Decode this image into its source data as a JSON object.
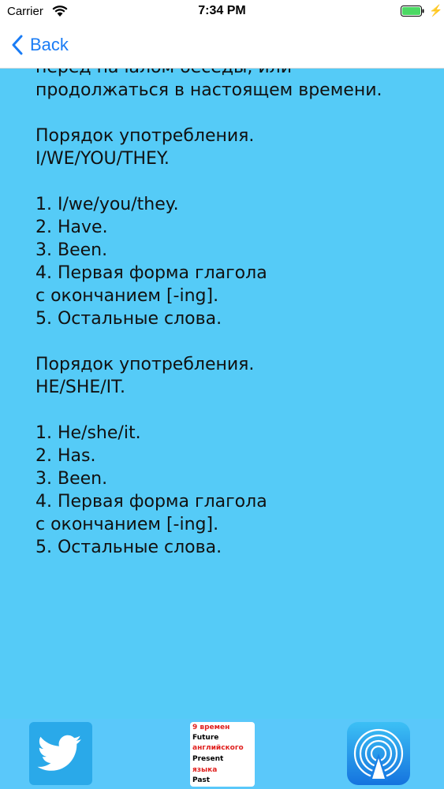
{
  "status_bar": {
    "carrier": "Carrier",
    "time": "7:34 PM",
    "wifi_icon": "wifi-icon",
    "battery_icon": "battery-icon"
  },
  "nav": {
    "back_label": "Back",
    "back_icon": "chevron-left-icon",
    "accent_color": "#1a7cf5"
  },
  "content": {
    "background": "#55cbf7",
    "lines": [
      "перед началом беседы, или",
      "продолжаться в настоящем времени.",
      "",
      "Порядок употребления.",
      "I/WE/YOU/THEY.",
      "",
      "1. I/we/you/they.",
      "2. Have.",
      "3. Been.",
      "4. Первая форма глагола",
      "с окончанием [-ing].",
      "5. Остальные слова.",
      "",
      "Порядок употребления.",
      "HE/SHE/IT.",
      "",
      "1. He/she/it.",
      "2. Has.",
      "3. Been.",
      "4. Первая форма глагола",
      "с окончанием [-ing].",
      "5. Остальные слова."
    ]
  },
  "bottom_bar": {
    "buttons": [
      {
        "name": "twitter",
        "icon": "twitter-bird-icon"
      },
      {
        "name": "app-promo",
        "lines": [
          "9 времен",
          "Future",
          "английского",
          "Present",
          "языка",
          "Past"
        ],
        "colors": [
          "#e0201e",
          "#000000",
          "#e0201e",
          "#000000",
          "#e0201e",
          "#000000"
        ]
      },
      {
        "name": "airdrop",
        "icon": "airdrop-icon"
      }
    ]
  }
}
